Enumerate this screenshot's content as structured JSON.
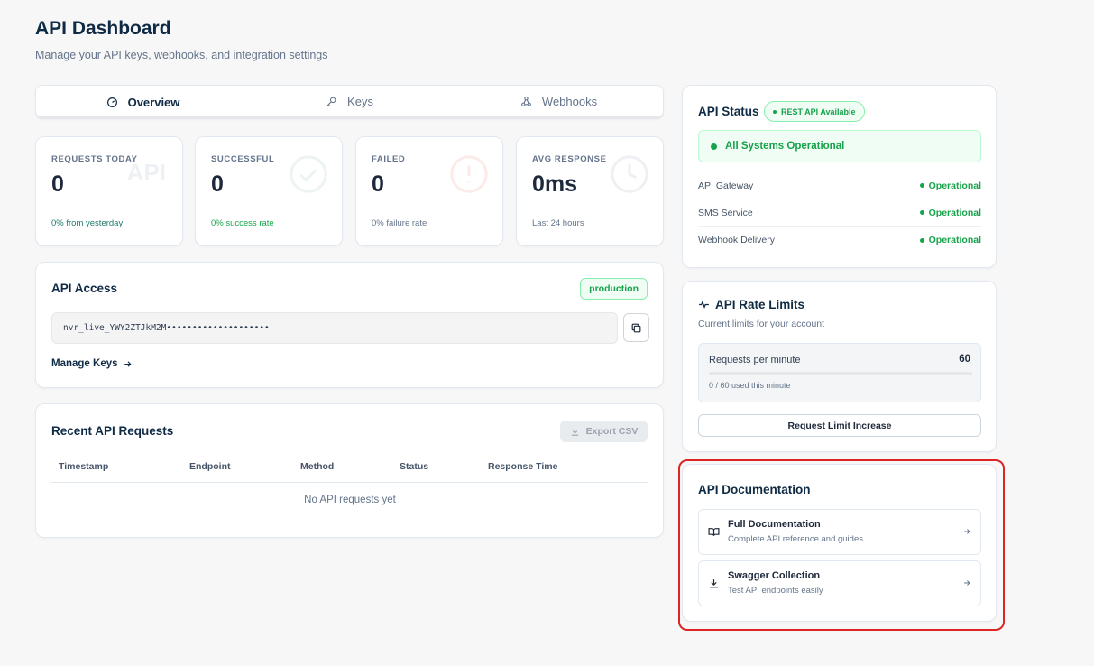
{
  "header": {
    "title": "API Dashboard",
    "subtitle": "Manage your API keys, webhooks, and integration settings"
  },
  "tabs": [
    {
      "label": "Overview",
      "icon": "gauge-icon",
      "active": true
    },
    {
      "label": "Keys",
      "icon": "key-icon",
      "active": false
    },
    {
      "label": "Webhooks",
      "icon": "webhook-icon",
      "active": false
    }
  ],
  "stats": [
    {
      "label": "REQUESTS TODAY",
      "value": "0",
      "sub": "0% from yesterday",
      "watermark": "API"
    },
    {
      "label": "SUCCESSFUL",
      "value": "0",
      "sub": "0% success rate"
    },
    {
      "label": "FAILED",
      "value": "0",
      "sub": "0% failure rate"
    },
    {
      "label": "AVG RESPONSE",
      "value": "0ms",
      "sub": "Last 24 hours"
    }
  ],
  "access": {
    "title": "API Access",
    "env_badge": "production",
    "api_key": "nvr_live_YWY2ZTJkM2M••••••••••••••••••••",
    "manage_label": "Manage Keys"
  },
  "recent": {
    "title": "Recent API Requests",
    "export_label": "Export CSV",
    "columns": [
      "Timestamp",
      "Endpoint",
      "Method",
      "Status",
      "Response Time"
    ],
    "empty_text": "No API requests yet"
  },
  "status": {
    "title": "API Status",
    "badge": "REST API Available",
    "overall": "All Systems Operational",
    "services": [
      {
        "name": "API Gateway",
        "state": "Operational"
      },
      {
        "name": "SMS Service",
        "state": "Operational"
      },
      {
        "name": "Webhook Delivery",
        "state": "Operational"
      }
    ]
  },
  "rate": {
    "title": "API Rate Limits",
    "subtitle": "Current limits for your account",
    "limit_label": "Requests per minute",
    "limit_value": "60",
    "used_text": "0 / 60 used this minute",
    "used_fraction": 0,
    "button_label": "Request Limit Increase"
  },
  "docs": {
    "title": "API Documentation",
    "items": [
      {
        "title": "Full Documentation",
        "desc": "Complete API reference and guides",
        "icon": "book-icon"
      },
      {
        "title": "Swagger Collection",
        "desc": "Test API endpoints easily",
        "icon": "download-icon"
      }
    ]
  },
  "colors": {
    "accent": "#0f2a44",
    "success": "#16a34a",
    "highlight": "#dc2626"
  }
}
